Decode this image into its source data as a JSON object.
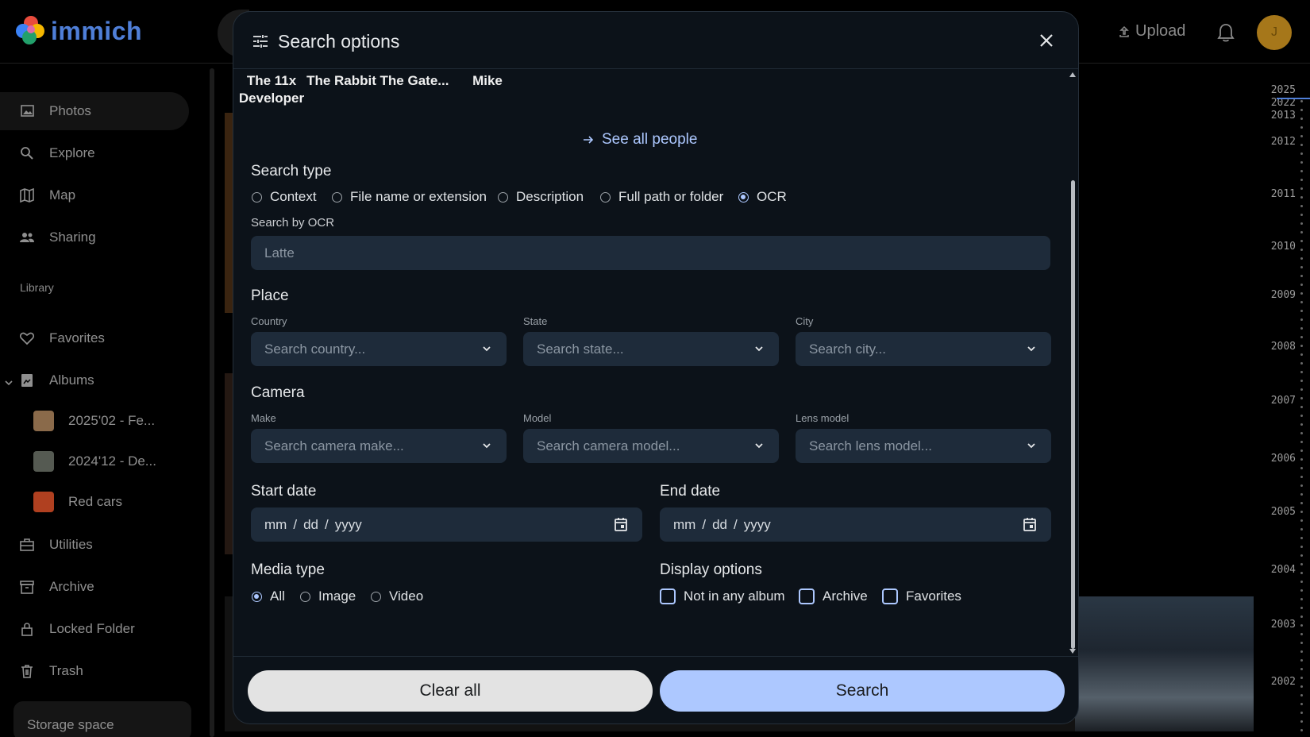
{
  "app": {
    "name": "immich"
  },
  "header": {
    "upload_label": "Upload",
    "avatar_initial": "J"
  },
  "sidebar": {
    "items": [
      {
        "label": "Photos",
        "icon": "photos-icon"
      },
      {
        "label": "Explore",
        "icon": "search-icon"
      },
      {
        "label": "Map",
        "icon": "map-icon"
      },
      {
        "label": "Sharing",
        "icon": "people-icon"
      }
    ],
    "library_label": "Library",
    "library_items": [
      {
        "label": "Favorites",
        "icon": "heart-icon"
      },
      {
        "label": "Albums",
        "icon": "album-icon"
      }
    ],
    "albums": [
      {
        "label": "2025'02 - Fe...",
        "color": "#8a6a4a"
      },
      {
        "label": "2024'12 - De...",
        "color": "#555a52"
      },
      {
        "label": "Red cars",
        "color": "#b04020"
      }
    ],
    "more_items": [
      {
        "label": "Utilities",
        "icon": "toolbox-icon"
      },
      {
        "label": "Archive",
        "icon": "archive-icon"
      },
      {
        "label": "Locked Folder",
        "icon": "lock-icon"
      },
      {
        "label": "Trash",
        "icon": "trash-icon"
      }
    ],
    "storage_label": "Storage space"
  },
  "timeline": {
    "years": [
      "2025",
      "2022",
      "2013",
      "2012",
      "2011",
      "2010",
      "2009",
      "2008",
      "2007",
      "2006",
      "2005",
      "2004",
      "2003",
      "2002"
    ]
  },
  "modal": {
    "title": "Search options",
    "people": [
      "The 11x Developer",
      "The Rabbit",
      "The Gate...",
      "Mike"
    ],
    "see_all_people": "See all people",
    "search_type": {
      "title": "Search type",
      "options": [
        "Context",
        "File name or extension",
        "Description",
        "Full path or folder",
        "OCR"
      ],
      "selected": "OCR"
    },
    "ocr": {
      "label": "Search by OCR",
      "placeholder": "Latte"
    },
    "place": {
      "title": "Place",
      "country_label": "Country",
      "country_placeholder": "Search country...",
      "state_label": "State",
      "state_placeholder": "Search state...",
      "city_label": "City",
      "city_placeholder": "Search city..."
    },
    "camera": {
      "title": "Camera",
      "make_label": "Make",
      "make_placeholder": "Search camera make...",
      "model_label": "Model",
      "model_placeholder": "Search camera model...",
      "lens_label": "Lens model",
      "lens_placeholder": "Search lens model..."
    },
    "start_date": {
      "title": "Start date",
      "mm": "mm",
      "dd": "dd",
      "yyyy": "yyyy",
      "sep": "/"
    },
    "end_date": {
      "title": "End date",
      "mm": "mm",
      "dd": "dd",
      "yyyy": "yyyy",
      "sep": "/"
    },
    "media_type": {
      "title": "Media type",
      "options": [
        "All",
        "Image",
        "Video"
      ],
      "selected": "All"
    },
    "display_options": {
      "title": "Display options",
      "options": [
        "Not in any album",
        "Archive",
        "Favorites"
      ]
    },
    "clear_label": "Clear all",
    "search_label": "Search"
  },
  "colors": {
    "accent": "#adc8ff",
    "modal_bg": "#0c1219",
    "field_bg": "#1e2b3a"
  }
}
